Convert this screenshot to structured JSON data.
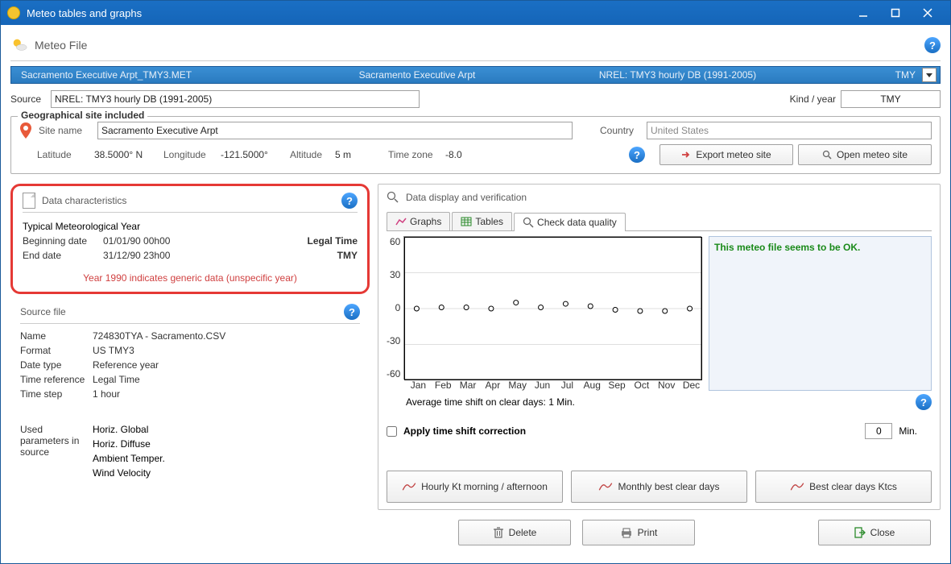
{
  "window": {
    "title": "Meteo tables and graphs"
  },
  "header": {
    "title": "Meteo File"
  },
  "fileBar": {
    "filename": "Sacramento Executive Arpt_TMY3.MET",
    "station": "Sacramento Executive Arpt",
    "db": "NREL: TMY3 hourly DB (1991-2005)",
    "kind": "TMY"
  },
  "sourceRow": {
    "label": "Source",
    "value": "NREL: TMY3 hourly DB (1991-2005)",
    "kindLabel": "Kind / year",
    "kindValue": "TMY"
  },
  "geo": {
    "legend": "Geographical site included",
    "siteNameLabel": "Site name",
    "siteName": "Sacramento Executive Arpt",
    "countryLabel": "Country",
    "country": "United States",
    "latitudeLabel": "Latitude",
    "latitude": "38.5000° N",
    "longitudeLabel": "Longitude",
    "longitude": "-121.5000°",
    "altitudeLabel": "Altitude",
    "altitude": "5 m",
    "timezoneLabel": "Time zone",
    "timezone": "-8.0",
    "exportBtn": "Export meteo site",
    "openBtn": "Open meteo site"
  },
  "dataChar": {
    "title": "Data characteristics",
    "tmy": "Typical Meteorological Year",
    "beginLabel": "Beginning date",
    "beginValue": "01/01/90 00h00",
    "legal": "Legal Time",
    "endLabel": "End date",
    "endValue": "31/12/90 23h00",
    "tmyRight": "TMY",
    "note": "Year 1990 indicates generic data (unspecific year)"
  },
  "sourceFile": {
    "title": "Source file",
    "nameLabel": "Name",
    "name": "724830TYA - Sacramento.CSV",
    "formatLabel": "Format",
    "format": "US TMY3",
    "dateTypeLabel": "Date type",
    "dateType": "Reference year",
    "timeRefLabel": "Time reference",
    "timeRef": "Legal Time",
    "timeStepLabel": "Time step",
    "timeStep": "1 hour",
    "usedLabel1": "Used",
    "usedLabel2": "parameters in",
    "usedLabel3": "source",
    "p1": "Horiz. Global",
    "p2": "Horiz. Diffuse",
    "p3": "Ambient Temper.",
    "p4": "Wind Velocity"
  },
  "display": {
    "title": "Data display and verification",
    "tabGraphs": "Graphs",
    "tabTables": "Tables",
    "tabQuality": "Check data quality",
    "okMsg": "This meteo file seems to be OK.",
    "avgLabel": "Average time shift on clear days: 1 Min.",
    "applyLabel": "Apply time shift correction",
    "shiftValue": "0",
    "shiftUnit": "Min.",
    "btnHourly": "Hourly Kt morning / afternoon",
    "btnMonthly": "Monthly best clear days",
    "btnKtcs": "Best clear days Ktcs"
  },
  "bottom": {
    "delete": "Delete",
    "print": "Print",
    "close": "Close"
  },
  "chart_data": {
    "type": "scatter",
    "title": "",
    "xlabel": "",
    "ylabel": "",
    "ylim": [
      -60,
      60
    ],
    "yticks": [
      -60,
      -30,
      0,
      30,
      60
    ],
    "categories": [
      "Jan",
      "Feb",
      "Mar",
      "Apr",
      "May",
      "Jun",
      "Jul",
      "Aug",
      "Sep",
      "Oct",
      "Nov",
      "Dec"
    ],
    "values": [
      0,
      1,
      1,
      0,
      5,
      1,
      4,
      2,
      -1,
      -2,
      -2,
      0
    ]
  }
}
